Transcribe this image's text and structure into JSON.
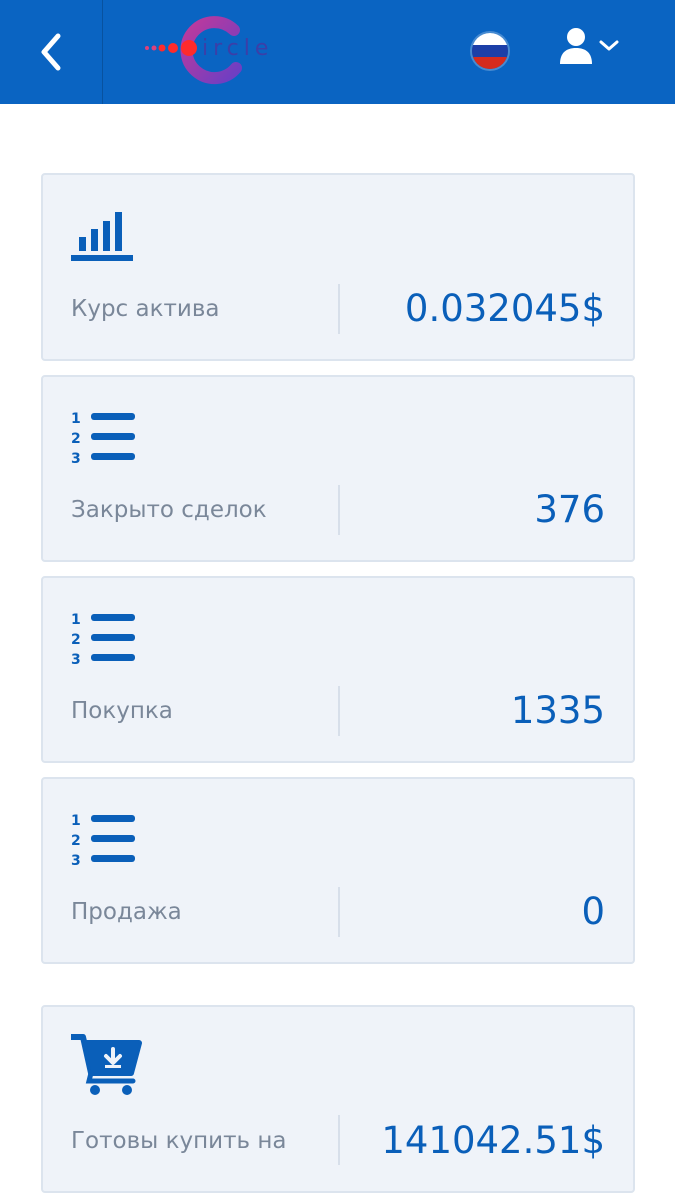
{
  "header": {
    "logo_text": "ircle",
    "accent": "#0a64c2"
  },
  "stats": [
    {
      "icon": "bar-chart-icon",
      "label": "Курс актива",
      "value": "0.032045$"
    },
    {
      "icon": "numbered-list-icon",
      "label": "Закрыто сделок",
      "value": "376"
    },
    {
      "icon": "numbered-list-icon",
      "label": "Покупка",
      "value": "1335"
    },
    {
      "icon": "numbered-list-icon",
      "label": "Продажа",
      "value": "0"
    }
  ],
  "cart_card": {
    "icon": "cart-download-icon",
    "label": "Готовы купить на",
    "value": "141042.51$"
  }
}
